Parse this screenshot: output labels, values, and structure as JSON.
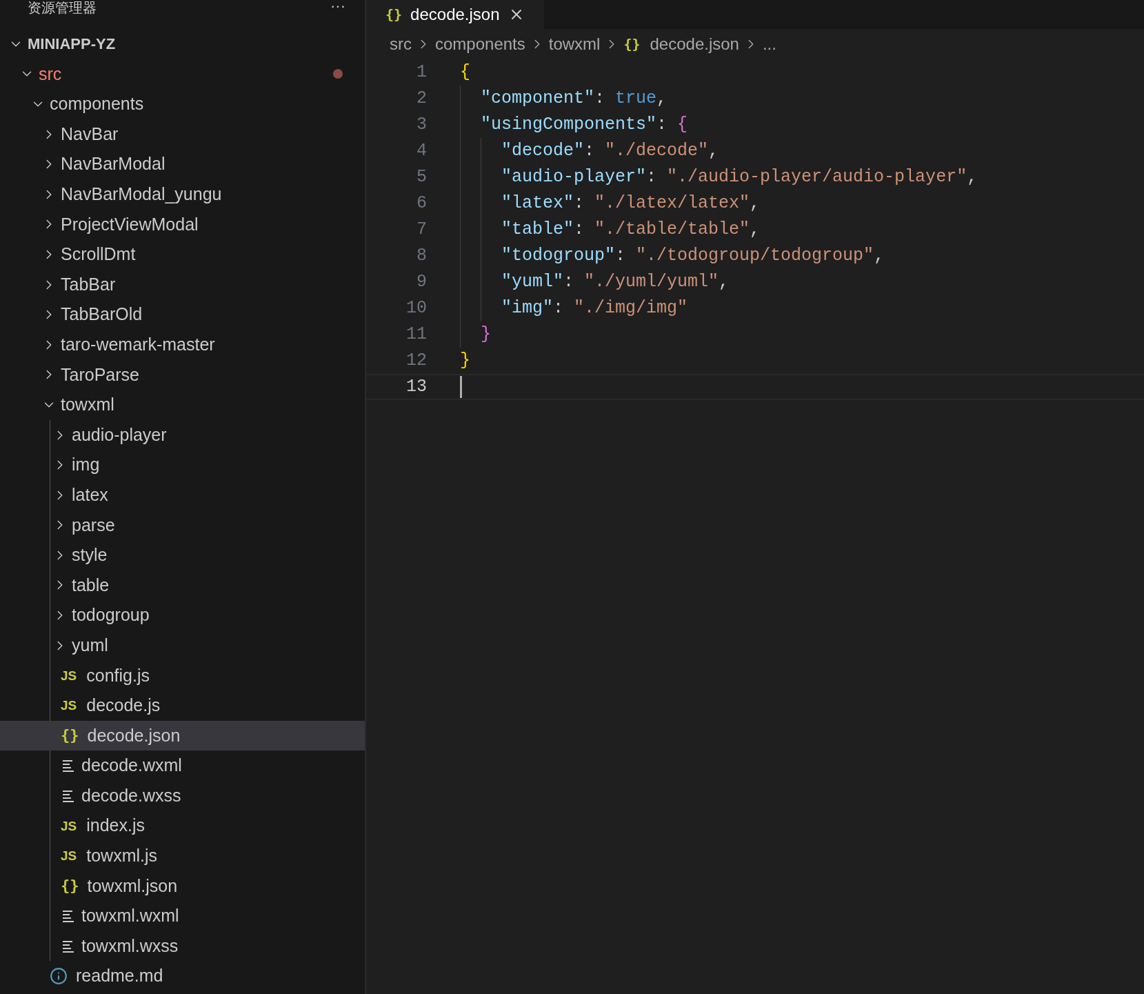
{
  "explorer": {
    "title": "资源管理器",
    "more": "···"
  },
  "tree": {
    "label": "MINIAPP-YZ",
    "kind": "root",
    "expanded": true,
    "children": [
      {
        "label": "src",
        "kind": "folder",
        "expanded": true,
        "problems": true,
        "children": [
          {
            "label": "components",
            "kind": "folder",
            "expanded": true,
            "problems": false,
            "children": [
              {
                "label": "NavBar",
                "kind": "folder",
                "expanded": false,
                "problems": false,
                "selected": false
              },
              {
                "label": "NavBarModal",
                "kind": "folder",
                "expanded": false,
                "problems": false,
                "selected": false
              },
              {
                "label": "NavBarModal_yungu",
                "kind": "folder",
                "expanded": false,
                "problems": false,
                "selected": false
              },
              {
                "label": "ProjectViewModal",
                "kind": "folder",
                "expanded": false,
                "problems": false,
                "selected": false
              },
              {
                "label": "ScrollDmt",
                "kind": "folder",
                "expanded": false,
                "problems": false,
                "selected": false
              },
              {
                "label": "TabBar",
                "kind": "folder",
                "expanded": false,
                "problems": false,
                "selected": false
              },
              {
                "label": "TabBarOld",
                "kind": "folder",
                "expanded": false,
                "problems": false,
                "selected": false
              },
              {
                "label": "taro-wemark-master",
                "kind": "folder",
                "expanded": false,
                "problems": false,
                "selected": false
              },
              {
                "label": "TaroParse",
                "kind": "folder",
                "expanded": false,
                "problems": false,
                "selected": false
              },
              {
                "label": "towxml",
                "kind": "folder",
                "expanded": true,
                "problems": false,
                "selected": false,
                "children": [
                  {
                    "label": "audio-player",
                    "kind": "folder",
                    "expanded": false,
                    "problems": false,
                    "selected": false
                  },
                  {
                    "label": "img",
                    "kind": "folder",
                    "expanded": false,
                    "problems": false,
                    "selected": false
                  },
                  {
                    "label": "latex",
                    "kind": "folder",
                    "expanded": false,
                    "problems": false,
                    "selected": false
                  },
                  {
                    "label": "parse",
                    "kind": "folder",
                    "expanded": false,
                    "problems": false,
                    "selected": false
                  },
                  {
                    "label": "style",
                    "kind": "folder",
                    "expanded": false,
                    "problems": false,
                    "selected": false
                  },
                  {
                    "label": "table",
                    "kind": "folder",
                    "expanded": false,
                    "problems": false,
                    "selected": false
                  },
                  {
                    "label": "todogroup",
                    "kind": "folder",
                    "expanded": false,
                    "problems": false,
                    "selected": false
                  },
                  {
                    "label": "yuml",
                    "kind": "folder",
                    "expanded": false,
                    "problems": false,
                    "selected": false
                  },
                  {
                    "label": "config.js",
                    "kind": "js",
                    "icon": "JS",
                    "problems": false,
                    "selected": false
                  },
                  {
                    "label": "decode.js",
                    "kind": "js",
                    "icon": "JS",
                    "problems": false,
                    "selected": false
                  },
                  {
                    "label": "decode.json",
                    "kind": "json",
                    "icon": "{}",
                    "problems": false,
                    "selected": true
                  },
                  {
                    "label": "decode.wxml",
                    "kind": "text",
                    "problems": false,
                    "selected": false
                  },
                  {
                    "label": "decode.wxss",
                    "kind": "text",
                    "problems": false,
                    "selected": false
                  },
                  {
                    "label": "index.js",
                    "kind": "js",
                    "icon": "JS",
                    "problems": false,
                    "selected": false
                  },
                  {
                    "label": "towxml.js",
                    "kind": "js",
                    "icon": "JS",
                    "problems": false,
                    "selected": false
                  },
                  {
                    "label": "towxml.json",
                    "kind": "json",
                    "icon": "{}",
                    "problems": false,
                    "selected": false
                  },
                  {
                    "label": "towxml.wxml",
                    "kind": "text",
                    "problems": false,
                    "selected": false
                  },
                  {
                    "label": "towxml.wxss",
                    "kind": "text",
                    "problems": false,
                    "selected": false
                  }
                ]
              },
              {
                "label": "readme.md",
                "kind": "info",
                "problems": false,
                "selected": false
              }
            ]
          }
        ]
      }
    ]
  },
  "tabs": [
    {
      "label": "decode.json",
      "icon": "{}",
      "selected": true
    }
  ],
  "breadcrumb": [
    {
      "label": "src"
    },
    {
      "label": "components"
    },
    {
      "label": "towxml"
    },
    {
      "label": "decode.json",
      "icon": "{}"
    },
    {
      "label": "..."
    }
  ],
  "code": [
    {
      "number": "1",
      "current": false,
      "tokens": [
        {
          "kind": "brace1",
          "text": "{"
        }
      ]
    },
    {
      "number": "2",
      "current": false,
      "tokens": [
        {
          "kind": "key",
          "text": "  \"component\""
        },
        {
          "kind": "punct",
          "text": ": "
        },
        {
          "kind": "keyword",
          "text": "true"
        },
        {
          "kind": "punct",
          "text": ","
        }
      ]
    },
    {
      "number": "3",
      "current": false,
      "tokens": [
        {
          "kind": "key",
          "text": "  \"usingComponents\""
        },
        {
          "kind": "punct",
          "text": ": "
        },
        {
          "kind": "brace2",
          "text": "{"
        }
      ]
    },
    {
      "number": "4",
      "current": false,
      "tokens": [
        {
          "kind": "key",
          "text": "    \"decode\""
        },
        {
          "kind": "punct",
          "text": ": "
        },
        {
          "kind": "string",
          "text": "\"./decode\""
        },
        {
          "kind": "punct",
          "text": ","
        }
      ]
    },
    {
      "number": "5",
      "current": false,
      "tokens": [
        {
          "kind": "key",
          "text": "    \"audio-player\""
        },
        {
          "kind": "punct",
          "text": ": "
        },
        {
          "kind": "string",
          "text": "\"./audio-player/audio-player\""
        },
        {
          "kind": "punct",
          "text": ","
        }
      ]
    },
    {
      "number": "6",
      "current": false,
      "tokens": [
        {
          "kind": "key",
          "text": "    \"latex\""
        },
        {
          "kind": "punct",
          "text": ": "
        },
        {
          "kind": "string",
          "text": "\"./latex/latex\""
        },
        {
          "kind": "punct",
          "text": ","
        }
      ]
    },
    {
      "number": "7",
      "current": false,
      "tokens": [
        {
          "kind": "key",
          "text": "    \"table\""
        },
        {
          "kind": "punct",
          "text": ": "
        },
        {
          "kind": "string",
          "text": "\"./table/table\""
        },
        {
          "kind": "punct",
          "text": ","
        }
      ]
    },
    {
      "number": "8",
      "current": false,
      "tokens": [
        {
          "kind": "key",
          "text": "    \"todogroup\""
        },
        {
          "kind": "punct",
          "text": ": "
        },
        {
          "kind": "string",
          "text": "\"./todogroup/todogroup\""
        },
        {
          "kind": "punct",
          "text": ","
        }
      ]
    },
    {
      "number": "9",
      "current": false,
      "tokens": [
        {
          "kind": "key",
          "text": "    \"yuml\""
        },
        {
          "kind": "punct",
          "text": ": "
        },
        {
          "kind": "string",
          "text": "\"./yuml/yuml\""
        },
        {
          "kind": "punct",
          "text": ","
        }
      ]
    },
    {
      "number": "10",
      "current": false,
      "tokens": [
        {
          "kind": "key",
          "text": "    \"img\""
        },
        {
          "kind": "punct",
          "text": ": "
        },
        {
          "kind": "string",
          "text": "\"./img/img\""
        }
      ]
    },
    {
      "number": "11",
      "current": false,
      "tokens": [
        {
          "kind": "brace2",
          "text": "  }"
        }
      ]
    },
    {
      "number": "12",
      "current": false,
      "tokens": [
        {
          "kind": "brace1",
          "text": "}"
        }
      ]
    },
    {
      "number": "13",
      "current": true
    }
  ]
}
